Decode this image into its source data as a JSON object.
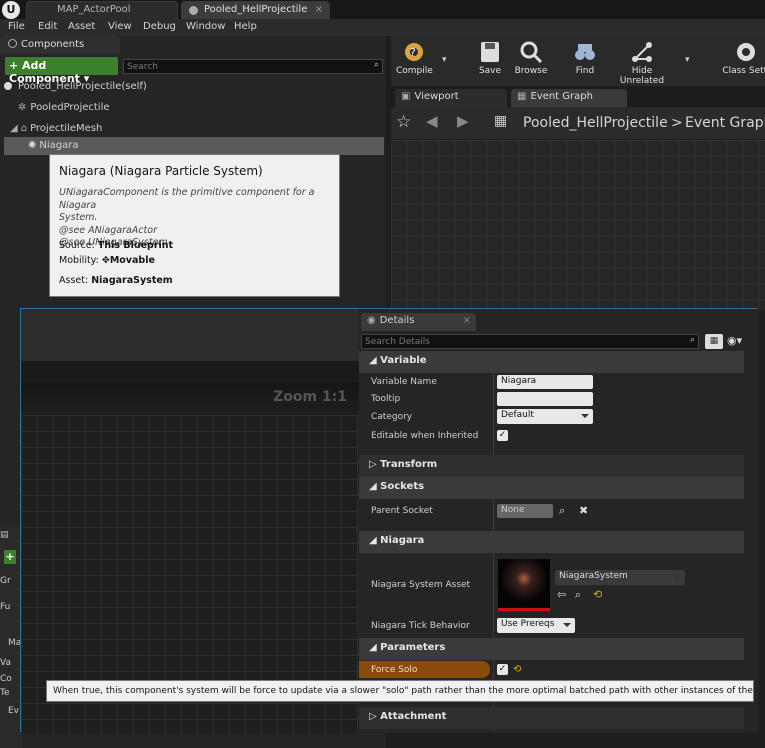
{
  "window": {
    "tabs": [
      {
        "label": "MAP_ActorPool"
      },
      {
        "label": "Pooled_HellProjectile"
      }
    ]
  },
  "menubar": {
    "items": [
      "File",
      "Edit",
      "Asset",
      "View",
      "Debug",
      "Window",
      "Help"
    ]
  },
  "components": {
    "title": "Components",
    "add_button": "+ Add Component ▾",
    "search_placeholder": "Search",
    "items": [
      {
        "label": "Pooled_HellProjectile(self)"
      },
      {
        "label": "PooledProjectile"
      },
      {
        "label": "ProjectileMesh"
      },
      {
        "label": "Niagara"
      }
    ]
  },
  "tooltip": {
    "title": "Niagara (Niagara Particle System)",
    "desc_lines": [
      "UNiagaraComponent is the primitive component for a Niagara",
      "System.",
      "@see ANiagaraActor",
      "@see UNiagaraSystem"
    ],
    "source_label": "Source:",
    "source_value": "This Blueprint",
    "mobility_label": "Mobility:",
    "mobility_value": "Movable",
    "asset_label": "Asset:",
    "asset_value": "NiagaraSystem"
  },
  "toolbar": {
    "buttons": [
      {
        "label": "Compile"
      },
      {
        "label": "Save"
      },
      {
        "label": "Browse"
      },
      {
        "label": "Find"
      },
      {
        "label": "Hide Unrelated"
      },
      {
        "label": "Class Setti"
      }
    ]
  },
  "graph_tabs": {
    "viewport": "Viewport",
    "event_graph": "Event Graph"
  },
  "breadcrumb": {
    "root": "Pooled_HellProjectile",
    "sep": ">",
    "current": "Event Graph"
  },
  "left_fragments": [
    "Gr",
    "Fu",
    "Ma",
    "Va",
    "Co",
    "Te",
    "Ev"
  ],
  "graph2": {
    "zoom": "Zoom 1:1"
  },
  "details": {
    "tab_label": "Details",
    "search_placeholder": "Search Details",
    "variable": {
      "header": "Variable",
      "name_label": "Variable Name",
      "name_value": "Niagara",
      "tooltip_label": "Tooltip",
      "tooltip_value": "",
      "category_label": "Category",
      "category_value": "Default",
      "editable_label": "Editable when Inherited"
    },
    "transform": {
      "header": "Transform"
    },
    "sockets": {
      "header": "Sockets",
      "parent_label": "Parent Socket",
      "parent_value": "None"
    },
    "niagara": {
      "header": "Niagara",
      "asset_label": "Niagara System Asset",
      "asset_value": "NiagaraSystem",
      "tick_label": "Niagara Tick Behavior",
      "tick_value": "Use Prereqs"
    },
    "parameters": {
      "header": "Parameters",
      "force_solo_label": "Force Solo"
    },
    "attachment": {
      "header": "Attachment"
    }
  },
  "hint": "When true, this component's system will be force to update via a slower \"solo\" path rather than the more optimal batched path with other instances of the same system."
}
